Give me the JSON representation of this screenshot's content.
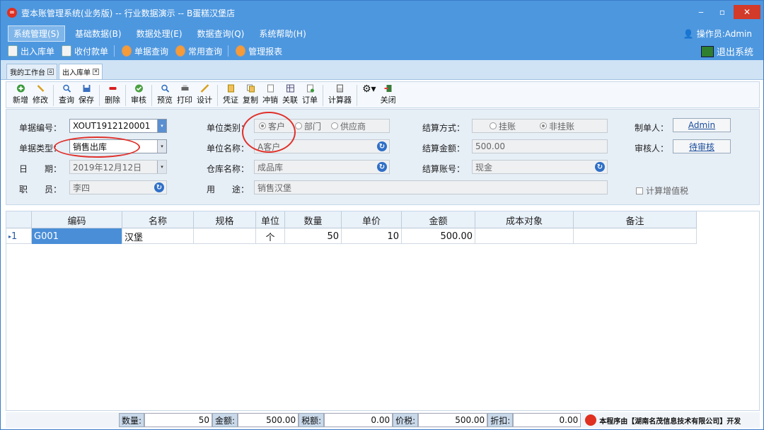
{
  "window": {
    "title": "壹本账管理系统(业务版) -- 行业数据演示 -- B蛋糕汉堡店",
    "min": "‒",
    "max": "▫",
    "close": "✕"
  },
  "menu": {
    "items": [
      "系统管理(S)",
      "基础数据(B)",
      "数据处理(E)",
      "数据查询(Q)",
      "系统帮助(H)"
    ],
    "operator": "操作员:Admin"
  },
  "quick": {
    "items": [
      "出入库单",
      "收付款单",
      "单据查询",
      "常用查询",
      "管理报表"
    ],
    "exit": "退出系统"
  },
  "tabs": {
    "workbench": "我的工作台",
    "active": "出入库单"
  },
  "toolbar": {
    "buttons": [
      "新增",
      "修改",
      "查询",
      "保存",
      "删除",
      "审核",
      "预览",
      "打印",
      "设计",
      "凭证",
      "复制",
      "冲销",
      "关联",
      "订单",
      "计算器",
      "关闭"
    ]
  },
  "form": {
    "doc_no_label": "单据编号：",
    "doc_no": "XOUT1912120001",
    "doc_type_label": "单据类型：",
    "doc_type": "销售出库",
    "date_label": "日　　期：",
    "date": "2019年12月12日",
    "staff_label": "职　　员：",
    "staff": "李四",
    "unit_cat_label": "单位类别：",
    "unit_cat_options": [
      "客户",
      "部门",
      "供应商"
    ],
    "unit_name_label": "单位名称：",
    "unit_name": "A客户",
    "warehouse_label": "仓库名称：",
    "warehouse": "成品库",
    "purpose_label": "用　　途：",
    "purpose": "销售汉堡",
    "settle_mode_label": "结算方式：",
    "settle_mode_options": [
      "挂账",
      "非挂账"
    ],
    "settle_amount_label": "结算金额：",
    "settle_amount": "500.00",
    "settle_account_label": "结算账号：",
    "settle_account": "现金",
    "maker_label": "制单人：",
    "maker": "Admin",
    "auditor_label": "审核人：",
    "auditor": "待审核",
    "vat_label": "计算增值税"
  },
  "grid": {
    "columns": [
      "编码",
      "名称",
      "规格",
      "单位",
      "数量",
      "单价",
      "金额",
      "成本对象",
      "备注"
    ],
    "rows": [
      {
        "index": "1",
        "code": "G001",
        "name": "汉堡",
        "spec": "",
        "unit": "个",
        "qty": "50",
        "price": "10",
        "amount": "500.00",
        "cost": "",
        "note": ""
      }
    ]
  },
  "status": {
    "qty_label": "数量:",
    "qty": "50",
    "amount_label": "金额:",
    "amount": "500.00",
    "tax_label": "税额:",
    "tax": "0.00",
    "total_label": "价税:",
    "total": "500.00",
    "discount_label": "折扣:",
    "discount": "0.00",
    "credit": "本程序由【湖南名茂信息技术有限公司】开发"
  },
  "colors": {
    "titlebar": "#4d97df",
    "highlight": "#e0302a"
  }
}
